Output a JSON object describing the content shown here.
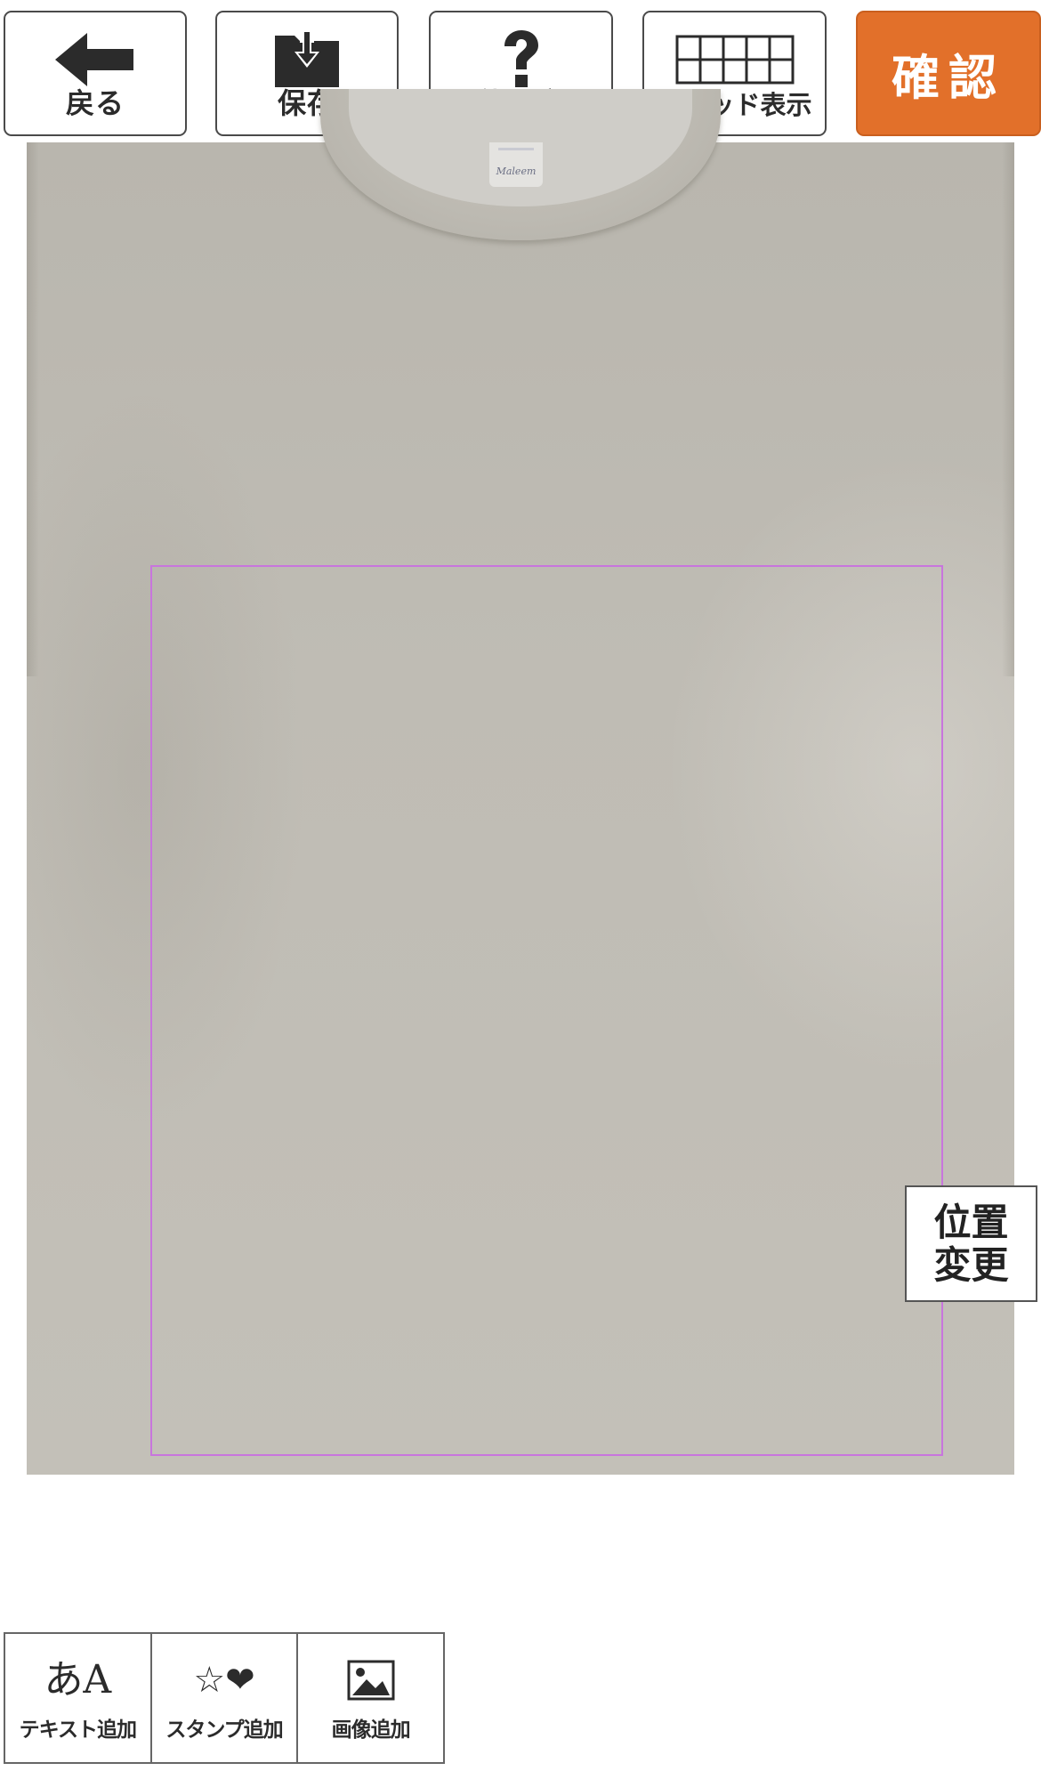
{
  "toolbar": {
    "back_label": "戻る",
    "save_label": "保存",
    "help_label": "使い方",
    "grid_label": "グリッド表示",
    "confirm_label": "確認"
  },
  "canvas": {
    "reposition_label": "位置変更",
    "collar_tag_text": "Maleem"
  },
  "palette": {
    "items": [
      {
        "label": "テキスト追加",
        "icon_glyph": "あA",
        "icon": "text-icon"
      },
      {
        "label": "スタンプ追加",
        "icon_glyph": "☆❤",
        "icon": "stamp-icon"
      },
      {
        "label": "画像追加",
        "icon": "image-icon"
      }
    ]
  },
  "colors": {
    "confirm_bg": "#e2702a",
    "print_area_border": "#c875dd",
    "shirt": "#bfbcb4"
  }
}
